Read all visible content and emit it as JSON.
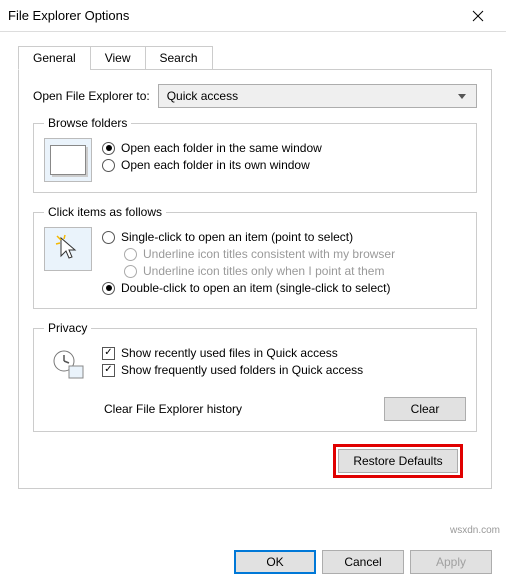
{
  "window": {
    "title": "File Explorer Options"
  },
  "tabs": {
    "general": "General",
    "view": "View",
    "search": "Search"
  },
  "open_to": {
    "label": "Open File Explorer to:",
    "value": "Quick access"
  },
  "browse": {
    "legend": "Browse folders",
    "same": "Open each folder in the same window",
    "own": "Open each folder in its own window"
  },
  "click": {
    "legend": "Click items as follows",
    "single": "Single-click to open an item (point to select)",
    "ul_browser": "Underline icon titles consistent with my browser",
    "ul_point": "Underline icon titles only when I point at them",
    "double": "Double-click to open an item (single-click to select)"
  },
  "privacy": {
    "legend": "Privacy",
    "recent_files": "Show recently used files in Quick access",
    "freq_folders": "Show frequently used folders in Quick access",
    "clear_label": "Clear File Explorer history",
    "clear_btn": "Clear"
  },
  "buttons": {
    "restore": "Restore Defaults",
    "ok": "OK",
    "cancel": "Cancel",
    "apply": "Apply"
  },
  "watermark": "wsxdn.com"
}
